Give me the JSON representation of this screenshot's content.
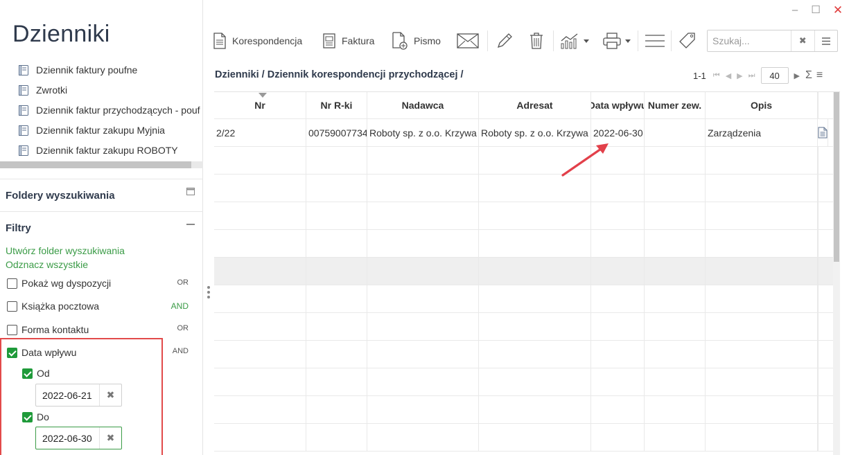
{
  "app_title": "Dzienniki",
  "journals": [
    {
      "label": "Dziennik faktury poufne"
    },
    {
      "label": "Zwrotki"
    },
    {
      "label": "Dziennik faktur przychodzących - pouf"
    },
    {
      "label": "Dziennik faktur zakupu Myjnia"
    },
    {
      "label": "Dziennik faktur zakupu ROBOTY"
    }
  ],
  "sections": {
    "search_folders": "Foldery wyszukiwania",
    "filters": "Filtry"
  },
  "filters": {
    "create_folder_link": "Utwórz folder wyszukiwania",
    "uncheck_all_link": "Odznacz wszystkie",
    "items": [
      {
        "label": "Pokaż wg dyspozycji",
        "checked": false,
        "op": "OR"
      },
      {
        "label": "Książka pocztowa",
        "checked": false,
        "op": "AND"
      },
      {
        "label": "Forma kontaktu",
        "checked": false,
        "op": "OR"
      },
      {
        "label": "Data wpływu",
        "checked": true,
        "op": "AND"
      }
    ],
    "date_from": {
      "label": "Od",
      "checked": true,
      "value": "2022-06-21"
    },
    "date_to": {
      "label": "Do",
      "checked": true,
      "value": "2022-06-30"
    }
  },
  "toolbar": {
    "korespondencja": "Korespondencja",
    "faktura": "Faktura",
    "pismo": "Pismo",
    "search_placeholder": "Szukaj..."
  },
  "breadcrumb": "Dzienniki / Dziennik korespondencji przychodzącej /",
  "pager": {
    "range": "1-1",
    "page_size": "40"
  },
  "grid": {
    "columns": [
      "Nr",
      "Nr R-ki",
      "Nadawca",
      "Adresat",
      "Data wpływu",
      "Numer zew.",
      "Opis"
    ],
    "rows": [
      {
        "nr": "2/22",
        "nr_rki": "00759007734",
        "nadawca": "Roboty sp. z o.o. Krzywa",
        "adresat": "Roboty sp. z o.o. Krzywa",
        "data_wplywu": "2022-06-30",
        "numer_zew": "",
        "opis": "Zarządzenia"
      }
    ]
  },
  "colors": {
    "accent_green": "#3a9b46",
    "highlight_red": "#e24a4a",
    "title": "#2f3a4c"
  }
}
